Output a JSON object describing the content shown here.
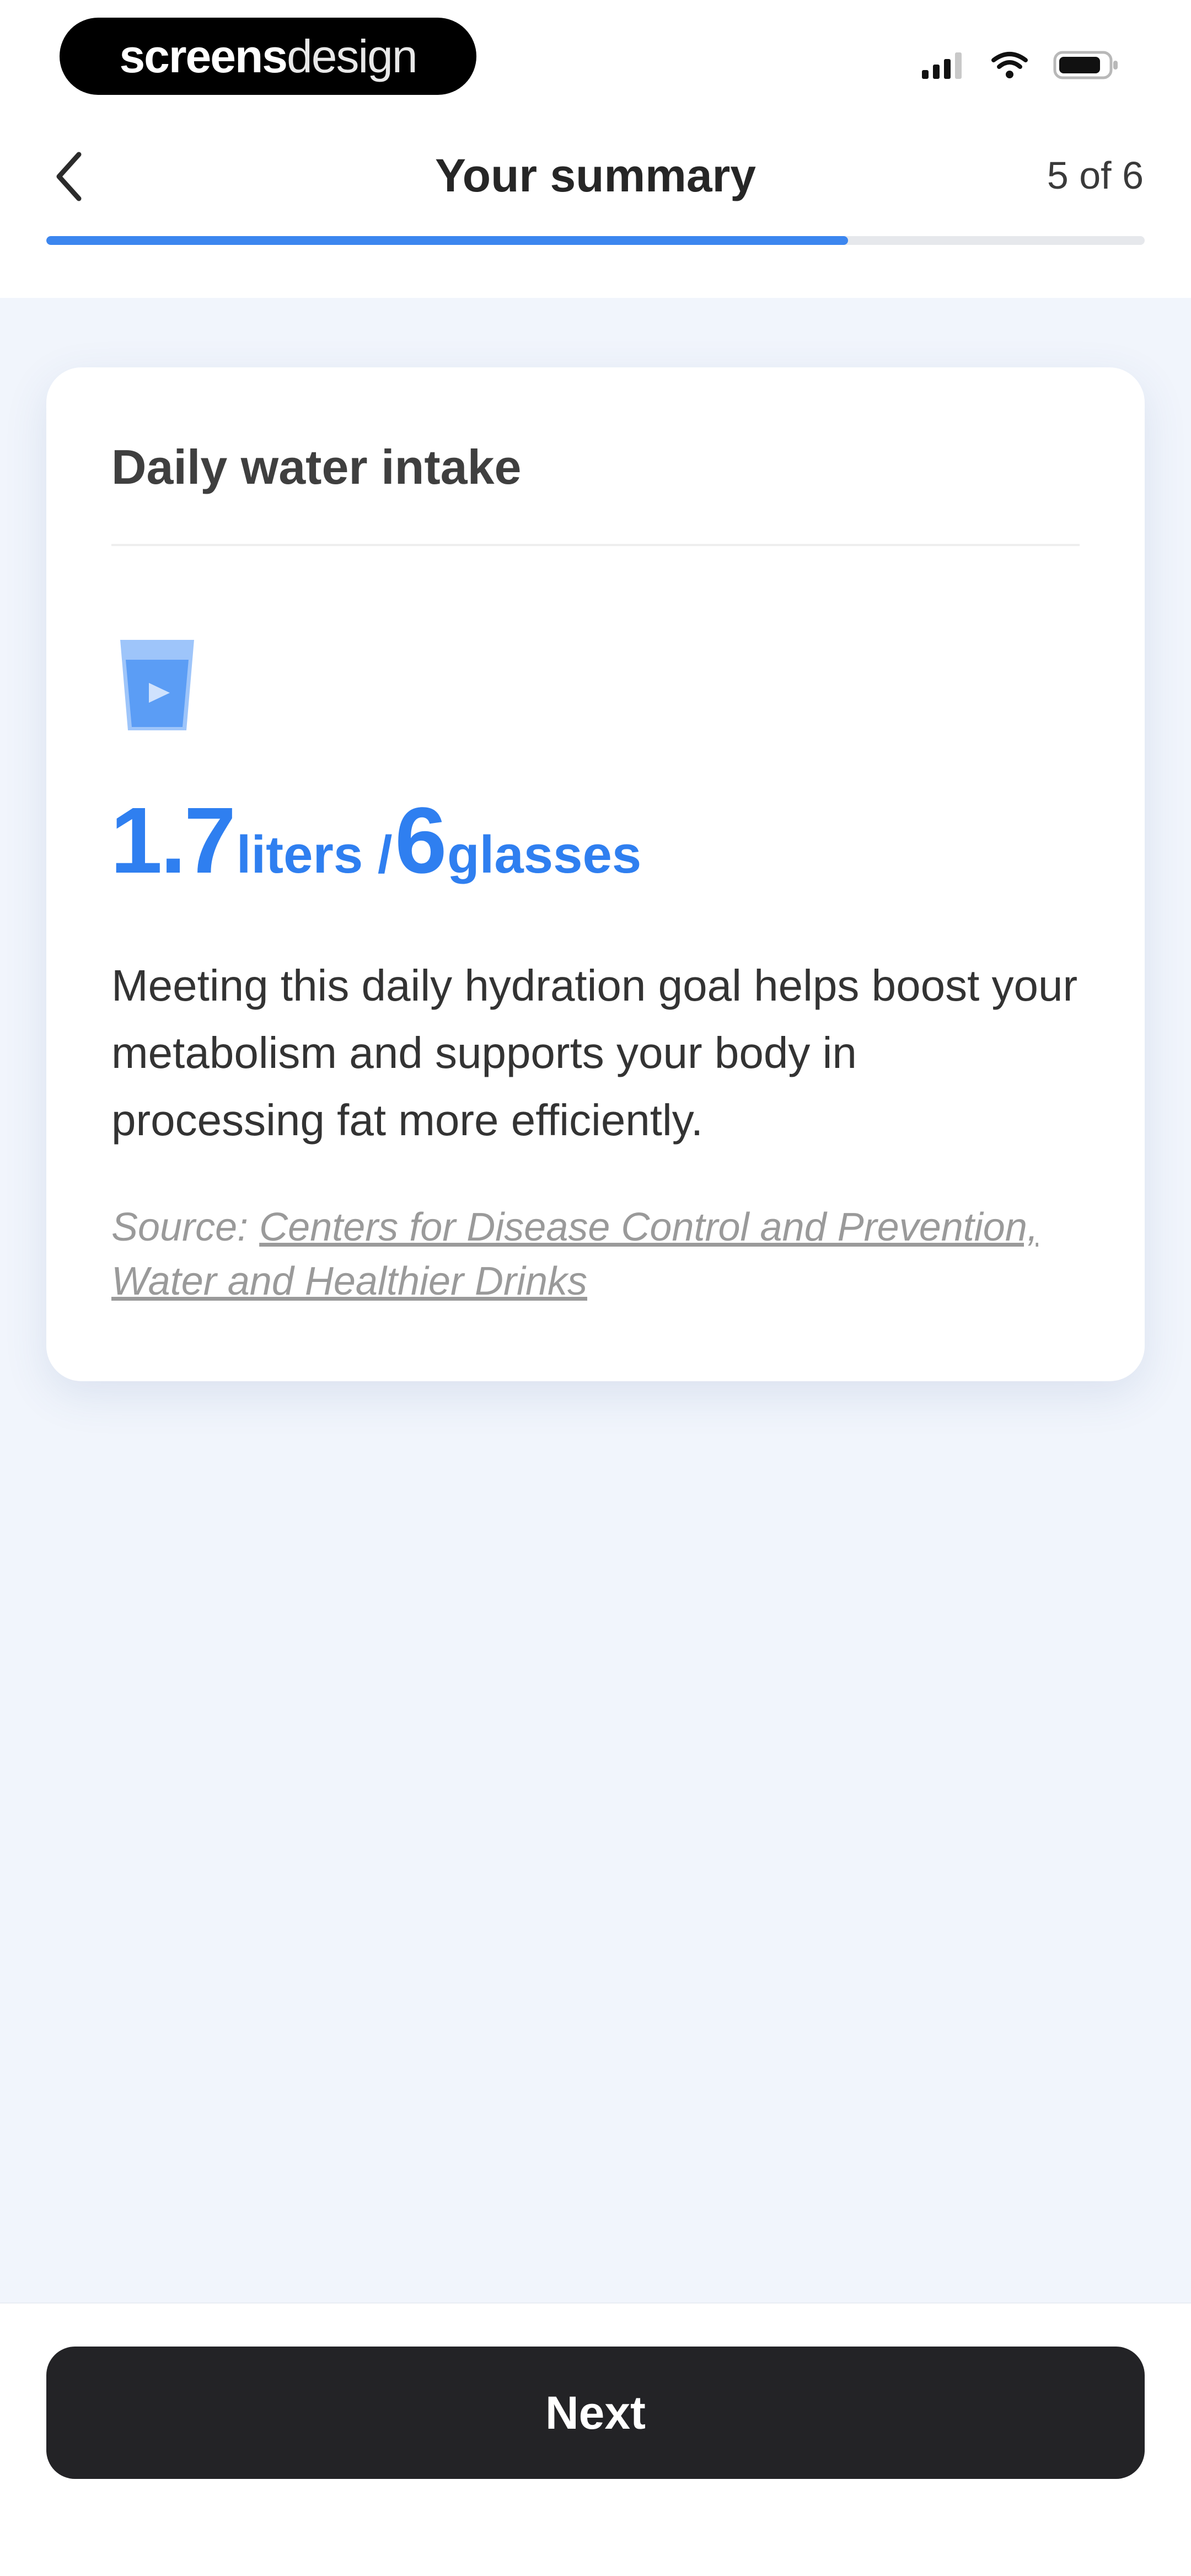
{
  "logo": {
    "bold": "screens",
    "light": "design"
  },
  "header": {
    "title": "Your summary",
    "step": "5 of 6",
    "progress": 0.73
  },
  "card": {
    "title": "Daily water intake",
    "icon": "water-glass-icon",
    "intake": {
      "liters": "1.7",
      "liters_unit": "liters /",
      "glasses": "6",
      "glasses_unit": "glasses"
    },
    "description": "Meeting this daily hydration goal helps boost your metabolism and supports your body in processing fat more efficiently.",
    "source_label": "Source:",
    "source_link": "Centers for Disease Control and Prevention, Water and Healthier Drinks"
  },
  "footer": {
    "next_label": "Next"
  },
  "colors": {
    "accent": "#3c86ef",
    "button": "#232326",
    "background": "#f1f5fc"
  }
}
